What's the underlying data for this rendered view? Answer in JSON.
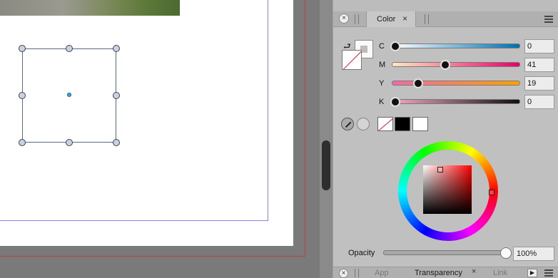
{
  "panel": {
    "active_tab": "Color",
    "cmyk": [
      {
        "label": "C",
        "value": "0",
        "fraction": 0.0,
        "gradient": "linear-gradient(90deg, #ffffff, #0070b0)"
      },
      {
        "label": "M",
        "value": "41",
        "fraction": 0.41,
        "gradient": "linear-gradient(90deg, #ffe8c0, #e8006a)"
      },
      {
        "label": "Y",
        "value": "19",
        "fraction": 0.19,
        "gradient": "linear-gradient(90deg, #f06aa8, #ffa000)"
      },
      {
        "label": "K",
        "value": "0",
        "fraction": 0.0,
        "gradient": "linear-gradient(90deg, #f2a8c6, #111111)"
      }
    ],
    "opacity_label": "Opacity",
    "opacity_value": "100%",
    "opacity_fraction": 1.0
  },
  "bottom_tabs": [
    "App",
    "Transparency",
    "Link"
  ],
  "icons": {
    "close": "×",
    "swap": "⮐",
    "play": "▶"
  }
}
